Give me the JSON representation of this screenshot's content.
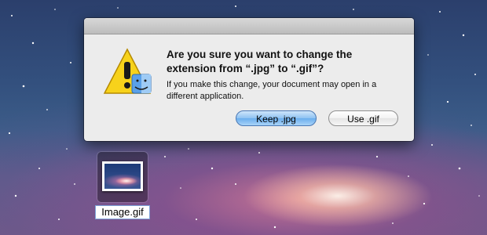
{
  "dialog": {
    "title_line": "Are you sure you want to change the extension from “.jpg” to “.gif”?",
    "body": "If you make this change, your document may open in a different application.",
    "primary_button": "Keep .jpg",
    "secondary_button": "Use .gif",
    "icon": "warning-finder-icon"
  },
  "desktop": {
    "file_name": "Image.gif",
    "file_icon": "image-file-icon"
  },
  "colors": {
    "dialog_bg": "#ececec",
    "primary_button": "#6aaeed",
    "warning_yellow": "#f7d21b"
  }
}
